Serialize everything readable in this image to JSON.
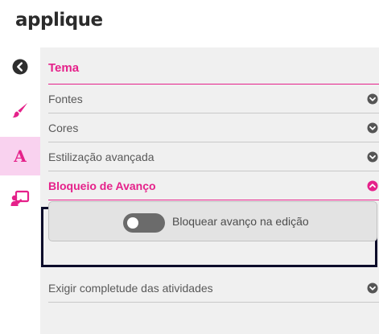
{
  "app": {
    "logo": "applique"
  },
  "sidebar": {
    "items": [
      {
        "icon": "back-arrow-circle-icon"
      },
      {
        "icon": "paintbrush-icon"
      },
      {
        "icon": "font-a-icon",
        "glyph": "A"
      },
      {
        "icon": "presenter-board-icon"
      }
    ],
    "colors": {
      "accent": "#e5218a",
      "active_bg": "#f9d2ef"
    }
  },
  "panel": {
    "section_title": "Tema",
    "rows": [
      {
        "label": "Fontes",
        "state": "collapsed"
      },
      {
        "label": "Cores",
        "state": "collapsed"
      },
      {
        "label": "Estilização avançada",
        "state": "collapsed"
      },
      {
        "label": "Bloqueio de Avanço",
        "state": "expanded"
      }
    ],
    "toggle": {
      "label": "Bloquear avanço na edição",
      "checked": false
    },
    "last_row": {
      "label": "Exigir completude das atividades",
      "state": "collapsed"
    }
  }
}
